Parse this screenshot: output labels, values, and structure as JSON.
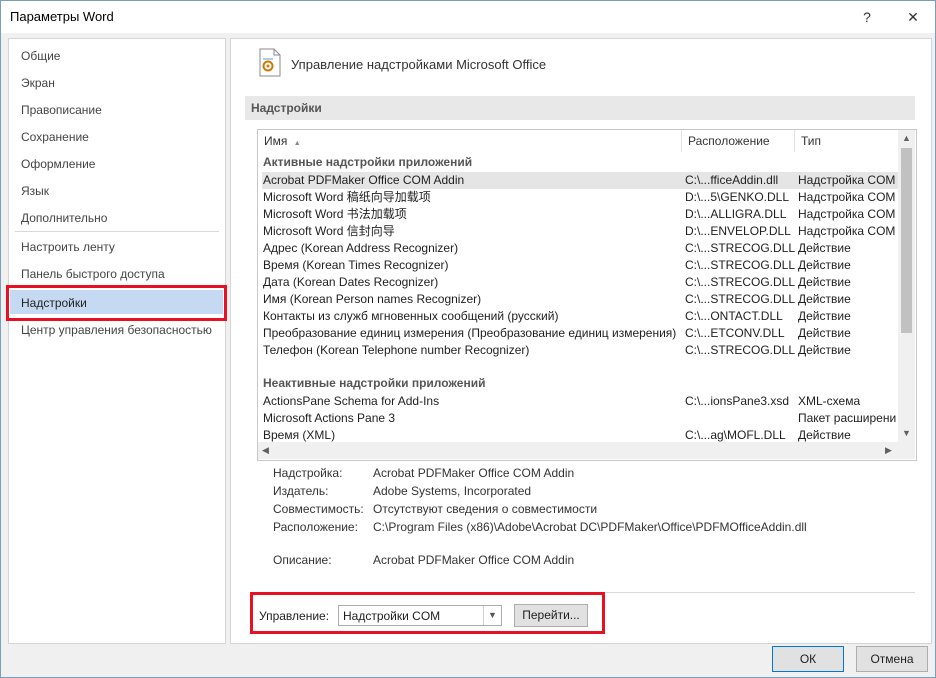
{
  "window": {
    "title": "Параметры Word",
    "help": "?",
    "close": "✕"
  },
  "sidebar": {
    "items": [
      {
        "label": "Общие"
      },
      {
        "label": "Экран"
      },
      {
        "label": "Правописание"
      },
      {
        "label": "Сохранение"
      },
      {
        "label": "Оформление"
      },
      {
        "label": "Язык"
      },
      {
        "label": "Дополнительно"
      },
      {
        "label": "Настроить ленту"
      },
      {
        "label": "Панель быстрого доступа"
      },
      {
        "label": "Надстройки"
      },
      {
        "label": "Центр управления безопасностью"
      }
    ],
    "selected": "Надстройки"
  },
  "main": {
    "header_title": "Управление надстройками Microsoft Office",
    "section_label": "Надстройки",
    "columns": {
      "name": "Имя",
      "sort_arrow": "▲",
      "location": "Расположение",
      "type": "Тип"
    },
    "active_group": "Активные надстройки приложений",
    "active_rows": [
      {
        "name": "Acrobat PDFMaker Office COM Addin",
        "location": "C:\\...fficeAddin.dll",
        "type": "Надстройка COM"
      },
      {
        "name": "Microsoft Word 稿纸向导加载项",
        "location": "D:\\...5\\GENKO.DLL",
        "type": "Надстройка COM"
      },
      {
        "name": "Microsoft Word 书法加载项",
        "location": "D:\\...ALLIGRA.DLL",
        "type": "Надстройка COM"
      },
      {
        "name": "Microsoft Word 信封向导",
        "location": "D:\\...ENVELOP.DLL",
        "type": "Надстройка COM"
      },
      {
        "name": "Адрес (Korean Address Recognizer)",
        "location": "C:\\...STRECOG.DLL",
        "type": "Действие"
      },
      {
        "name": "Время (Korean Times Recognizer)",
        "location": "C:\\...STRECOG.DLL",
        "type": "Действие"
      },
      {
        "name": "Дата (Korean Dates Recognizer)",
        "location": "C:\\...STRECOG.DLL",
        "type": "Действие"
      },
      {
        "name": "Имя (Korean Person names Recognizer)",
        "location": "C:\\...STRECOG.DLL",
        "type": "Действие"
      },
      {
        "name": "Контакты из служб мгновенных сообщений (русский)",
        "location": "C:\\...ONTACT.DLL",
        "type": "Действие"
      },
      {
        "name": "Преобразование единиц измерения (Преобразование единиц измерения)",
        "location": "C:\\...ETCONV.DLL",
        "type": "Действие"
      },
      {
        "name": "Телефон (Korean Telephone number Recognizer)",
        "location": "C:\\...STRECOG.DLL",
        "type": "Действие"
      }
    ],
    "inactive_group": "Неактивные надстройки приложений",
    "inactive_rows": [
      {
        "name": "ActionsPane Schema for Add-Ins",
        "location": "C:\\...ionsPane3.xsd",
        "type": "XML-схема"
      },
      {
        "name": "Microsoft Actions Pane 3",
        "location": "",
        "type": "Пакет расширени"
      },
      {
        "name": "Время (XML)",
        "location": "C:\\...ag\\MOFL.DLL",
        "type": "Действие"
      }
    ],
    "details": {
      "addin_label": "Надстройка:",
      "addin_value": "Acrobat PDFMaker Office COM Addin",
      "publisher_label": "Издатель:",
      "publisher_value": "Adobe Systems, Incorporated",
      "compat_label": "Совместимость:",
      "compat_value": "Отсутствуют сведения о совместимости",
      "location_label": "Расположение:",
      "location_value": "C:\\Program Files (x86)\\Adobe\\Acrobat DC\\PDFMaker\\Office\\PDFMOfficeAddin.dll",
      "desc_label": "Описание:",
      "desc_value": "Acrobat PDFMaker Office COM Addin"
    },
    "manage": {
      "label": "Управление:",
      "selected": "Надстройки COM",
      "go": "Перейти..."
    }
  },
  "footer": {
    "ok": "ОК",
    "cancel": "Отмена"
  },
  "colors": {
    "highlight_red": "#e81123",
    "selected_nav": "#c5d9f2",
    "accent_blue": "#0078d7"
  }
}
